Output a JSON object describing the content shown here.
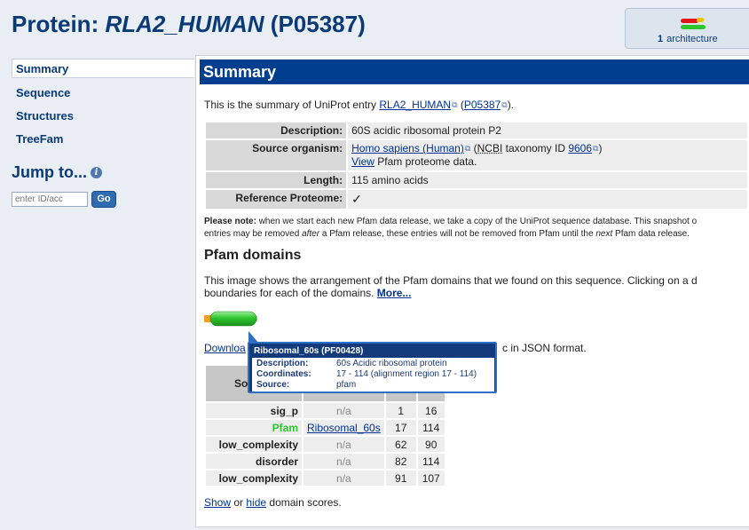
{
  "header": {
    "title_prefix": "Protein: ",
    "title_id": "RLA2_HUMAN",
    "title_suffix": " (P05387)",
    "architecture_count": "1",
    "architecture_label": "architecture"
  },
  "sidebar": {
    "items": [
      {
        "label": "Summary"
      },
      {
        "label": "Sequence"
      },
      {
        "label": "Structures"
      },
      {
        "label": "TreeFam"
      }
    ],
    "jump_title": "Jump to...",
    "jump_help": "i",
    "jump_placeholder": "enter ID/acc",
    "go_label": "Go"
  },
  "summary": {
    "heading": "Summary",
    "intro_before": "This is the summary of UniProt entry ",
    "intro_entry": "RLA2_HUMAN",
    "intro_mid": " (",
    "intro_acc": "P05387",
    "intro_after": ").",
    "rows": {
      "description_label": "Description:",
      "description_value": "60S acidic ribosomal protein P2",
      "organism_label": "Source organism:",
      "organism_link": "Homo sapiens (Human)",
      "organism_ncbi_open": " (",
      "organism_ncbi": "NCBI",
      "organism_taxid_text": " taxonomy ID ",
      "organism_taxid": "9606",
      "organism_close": ")",
      "view_link": "View",
      "view_text": " Pfam proteome data.",
      "length_label": "Length:",
      "length_value": "115 amino acids",
      "refprot_label": "Reference Proteome:",
      "refprot_value": "✓"
    },
    "note_bold": "Please note:",
    "note_line1": " when we start each new Pfam data release, we take a copy of the UniProt sequence database. This snapshot o",
    "note_line2_a": "entries may be removed ",
    "note_line2_after": "after",
    "note_line2_b": " a Pfam release, these entries will not be removed from Pfam until the ",
    "note_line2_next": "next",
    "note_line2_c": " Pfam data release."
  },
  "pfam": {
    "heading": "Pfam domains",
    "desc_line1": "This image shows the arrangement of the Pfam domains that we found on this sequence. Clicking on a d",
    "desc_line2": "boundaries for each of the domains. ",
    "more_link": "More...",
    "download_link": "Downloa",
    "download_tail": "c in JSON format.",
    "table_header": "So",
    "rows": [
      {
        "source": "sig_p",
        "entry": "n/a",
        "start": "1",
        "end": "16"
      },
      {
        "source": "Pfam",
        "entry": "Ribosomal_60s",
        "start": "17",
        "end": "114"
      },
      {
        "source": "low_complexity",
        "entry": "n/a",
        "start": "62",
        "end": "90"
      },
      {
        "source": "disorder",
        "entry": "n/a",
        "start": "82",
        "end": "114"
      },
      {
        "source": "low_complexity",
        "entry": "n/a",
        "start": "91",
        "end": "107"
      }
    ],
    "show_link": "Show",
    "or_text": " or ",
    "hide_link": "hide",
    "scores_text": " domain scores."
  },
  "tooltip": {
    "title": "Ribosomal_60s (PF00428)",
    "description_label": "Description:",
    "description_value": "60s Acidic ribosomal protein",
    "coordinates_label": "Coordinates:",
    "coordinates_value": "17 - 114 (alignment region 17 - 114)",
    "source_label": "Source:",
    "source_value": "pfam"
  },
  "colors": {
    "title_blue": "#0b3a78",
    "summary_bar": "#003f8f",
    "pfam_green": "#2ec52e",
    "tooltip_bg": "#133a7a"
  }
}
